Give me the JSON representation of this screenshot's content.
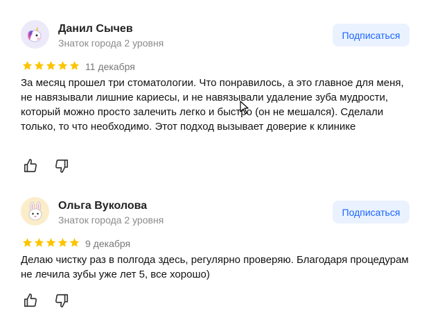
{
  "reviews": [
    {
      "author": "Данил Сычев",
      "level": "Знаток города 2 уровня",
      "subscribe_label": "Подписаться",
      "rating": 5,
      "date": "11 декабря",
      "text": "За месяц прошел три стоматологии. Что понравилось, а это главное для меня, не навязывали лишние кариесы, и не навязывали удаление зуба мудрости, который можно просто залечить легко и быстро (он не мешался). Сделали только, то что необходимо. Этот подход вызывает доверие к клинике",
      "avatar_icon": "unicorn-icon",
      "avatar_bg": "#ece9f8"
    },
    {
      "author": "Ольга Вуколова",
      "level": "Знаток города 2 уровня",
      "subscribe_label": "Подписаться",
      "rating": 5,
      "date": "9 декабря",
      "text": "Делаю чистку раз в полгода здесь, регулярно проверяю. Благодаря процедурам не лечила зубы уже лет 5, все хорошо)",
      "avatar_icon": "rabbit-icon",
      "avatar_bg": "#fbedc9"
    }
  ],
  "colors": {
    "star": "#fcc400",
    "subscribe_bg": "#eaf2ff",
    "subscribe_text": "#1a66ff"
  },
  "icons": [
    "thumbs-up-icon",
    "thumbs-down-icon",
    "star-icon",
    "mouse-cursor-icon"
  ]
}
